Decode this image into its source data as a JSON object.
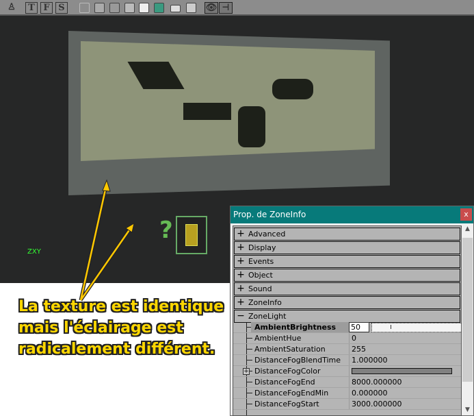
{
  "toolbar": {
    "text_buttons": [
      "T",
      "F",
      "S"
    ],
    "icons": [
      "joystick-icon",
      "wireframe-cube-icon",
      "zone-cube-icon",
      "texture-cube-icon",
      "shaded-cube-icon",
      "lit-cube-icon",
      "dynamic-light-cube-icon",
      "layers-icon",
      "pages-icon",
      "eye-icon",
      "pin-icon"
    ]
  },
  "viewport": {
    "axis_label": "ZXY"
  },
  "caption": {
    "lines": [
      "La texture est identique",
      "mais l'éclairage est",
      "radicalement différent."
    ]
  },
  "properties": {
    "title": "Prop. de ZoneInfo",
    "close": "x",
    "categories": [
      {
        "label": "Advanced",
        "sign": "+"
      },
      {
        "label": "Display",
        "sign": "+"
      },
      {
        "label": "Events",
        "sign": "+"
      },
      {
        "label": "Object",
        "sign": "+"
      },
      {
        "label": "Sound",
        "sign": "+"
      },
      {
        "label": "ZoneInfo",
        "sign": "+"
      },
      {
        "label": "ZoneLight",
        "sign": "−"
      }
    ],
    "rows": [
      {
        "name": "AmbientBrightness",
        "value": "50"
      },
      {
        "name": "AmbientHue",
        "value": "0"
      },
      {
        "name": "AmbientSaturation",
        "value": "255"
      },
      {
        "name": "DistanceFogBlendTime",
        "value": "1.000000"
      },
      {
        "name": "DistanceFogColor",
        "value": ""
      },
      {
        "name": "DistanceFogEnd",
        "value": "8000.000000"
      },
      {
        "name": "DistanceFogEndMin",
        "value": "0.000000"
      },
      {
        "name": "DistanceFogStart",
        "value": "3000.000000"
      }
    ],
    "fog_color": "#808080",
    "brightness_slider_fraction": 0.2
  }
}
